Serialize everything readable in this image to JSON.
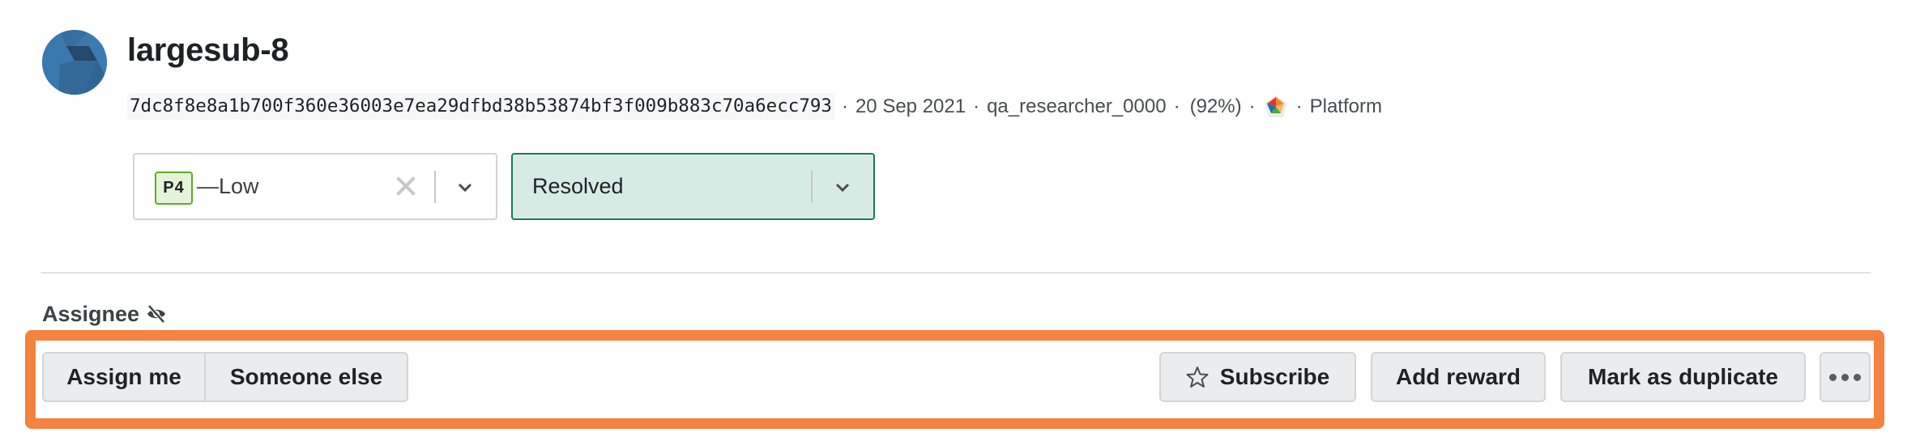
{
  "report": {
    "title": "largesub-8",
    "hash": "7dc8f8e8a1b700f360e36003e7ea29dfbd38b53874bf3f009b883c70a6ecc793",
    "date": "20 Sep 2021",
    "reporter": "qa_researcher_0000",
    "reputation": "(92%)",
    "asset": "Platform",
    "separator": "·"
  },
  "priority_select": {
    "badge": "P4",
    "value": "—Low",
    "icons": {
      "clear": "close-icon",
      "dropdown": "chevron-down-icon"
    }
  },
  "status_select": {
    "value": "Resolved",
    "icons": {
      "dropdown": "chevron-down-icon"
    }
  },
  "assignee": {
    "label": "Assignee",
    "icon": "eye-slash-icon"
  },
  "actions": {
    "assign_me": "Assign me",
    "someone_else": "Someone else",
    "subscribe": "Subscribe",
    "add_reward": "Add reward",
    "mark_duplicate": "Mark as duplicate",
    "more_icon": "ellipsis-icon"
  },
  "colors": {
    "highlight": "#f5823e",
    "status_border": "#1a7a5e",
    "status_bg": "#d7ebe5",
    "priority_badge_border": "#62a82b",
    "priority_badge_bg": "#e5f3d9",
    "avatar": "#3a78ad"
  }
}
